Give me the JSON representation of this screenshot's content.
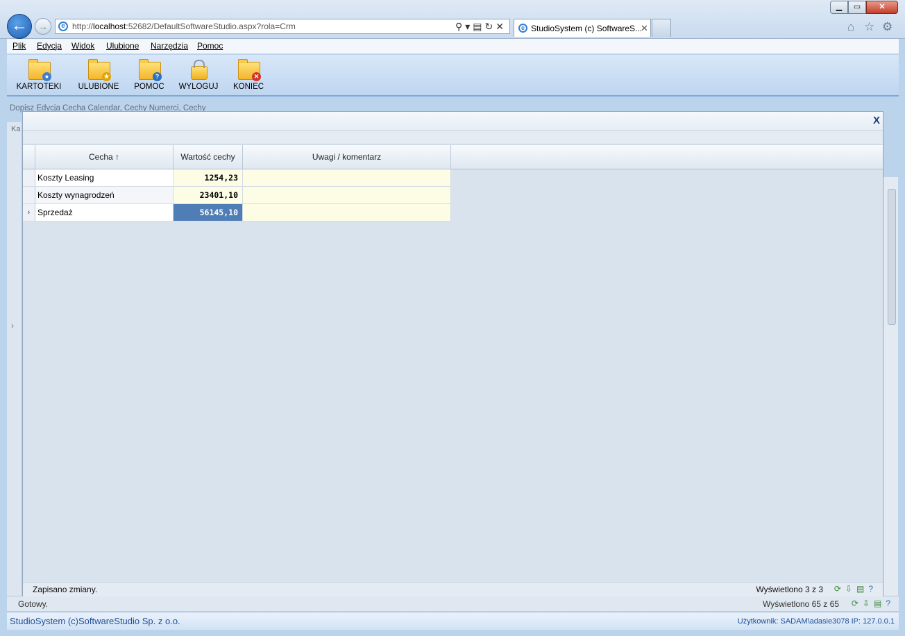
{
  "browser": {
    "url_prefix": "http://",
    "url_host": "localhost",
    "url_rest": ":52682/DefaultSoftwareStudio.aspx?rola=Crm",
    "tab_title": "StudioSystem (c) SoftwareS...",
    "tab_close": "✕"
  },
  "menu": {
    "items": [
      "Plik",
      "Edycja",
      "Widok",
      "Ulubione",
      "Narzędzia",
      "Pomoc"
    ]
  },
  "toolbar": {
    "buttons": [
      {
        "label": "KARTOTEKI",
        "icon": "folder-user-icon"
      },
      {
        "label": "ULUBIONE",
        "icon": "folder-star-icon"
      },
      {
        "label": "POMOC",
        "icon": "folder-help-icon"
      },
      {
        "label": "WYLOGUJ",
        "icon": "lock-icon"
      },
      {
        "label": "KONIEC",
        "icon": "folder-close-icon"
      }
    ]
  },
  "background": {
    "breadcrumb": "Dopisz   Edycja   Cecha Calendar, Cechy Numerci, Cechy",
    "left_label": "Ka",
    "status_text": "Gotowy.",
    "status_count": "Wyświetlono 65 z 65"
  },
  "dialog": {
    "close_label": "X",
    "columns": [
      "Cecha ↑",
      "Wartość cechy",
      "Uwagi / komentarz"
    ],
    "rows": [
      {
        "name": "Koszty Leasing",
        "value": "1254,23",
        "note": ""
      },
      {
        "name": "Koszty wynagrodzeń",
        "value": "23401,10",
        "note": ""
      },
      {
        "name": "Sprzedaż",
        "value": "56145,10",
        "note": ""
      }
    ],
    "current_row_marker": "›",
    "status_text": "Zapisano zmiany.",
    "status_count": "Wyświetlono 3 z 3"
  },
  "footer": {
    "app_name": "StudioSystem (c)SoftwareStudio Sp. z o.o.",
    "user_info": "Użytkownik: SADAM\\adasie3078 IP: 127.0.0.1"
  },
  "colors": {
    "selected_cell": "#4f7eb6",
    "editable_cell": "#fdfde6",
    "footer_text": "#1f4f96"
  }
}
